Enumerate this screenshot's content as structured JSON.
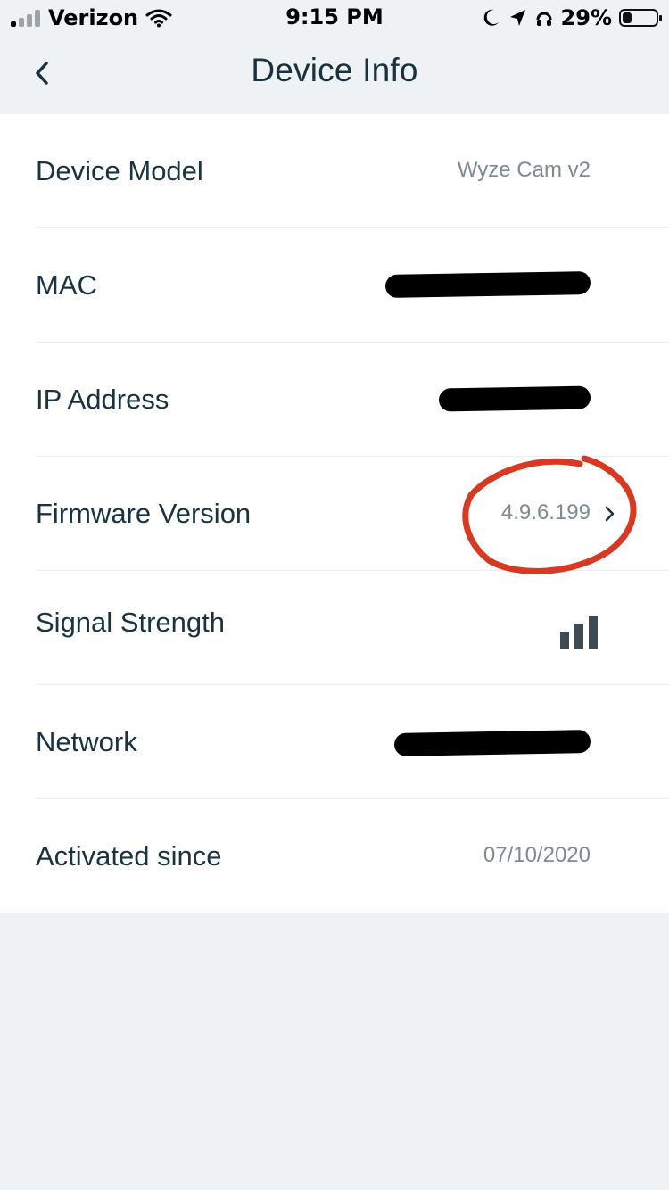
{
  "status_bar": {
    "carrier": "Verizon",
    "time": "9:15 PM",
    "battery_percent": "29%",
    "icons": [
      "signal-bars-icon",
      "wifi-icon",
      "moon-icon",
      "location-arrow-icon",
      "headphones-icon",
      "battery-icon"
    ]
  },
  "nav": {
    "title": "Device Info",
    "back_icon": "chevron-left-icon"
  },
  "rows": [
    {
      "label": "Device Model",
      "value": "Wyze Cam v2"
    },
    {
      "label": "MAC",
      "value": ""
    },
    {
      "label": "IP Address",
      "value": ""
    },
    {
      "label": "Firmware Version",
      "value": "4.9.6.199"
    },
    {
      "label": "Signal Strength",
      "value": ""
    },
    {
      "label": "Network",
      "value": ""
    },
    {
      "label": "Activated since",
      "value": "07/10/2020"
    }
  ],
  "colors": {
    "background": "#eef2f5",
    "surface": "#ffffff",
    "text_primary": "#1a3340",
    "text_secondary": "#7d8a93",
    "annotation_red": "#d63a22"
  }
}
